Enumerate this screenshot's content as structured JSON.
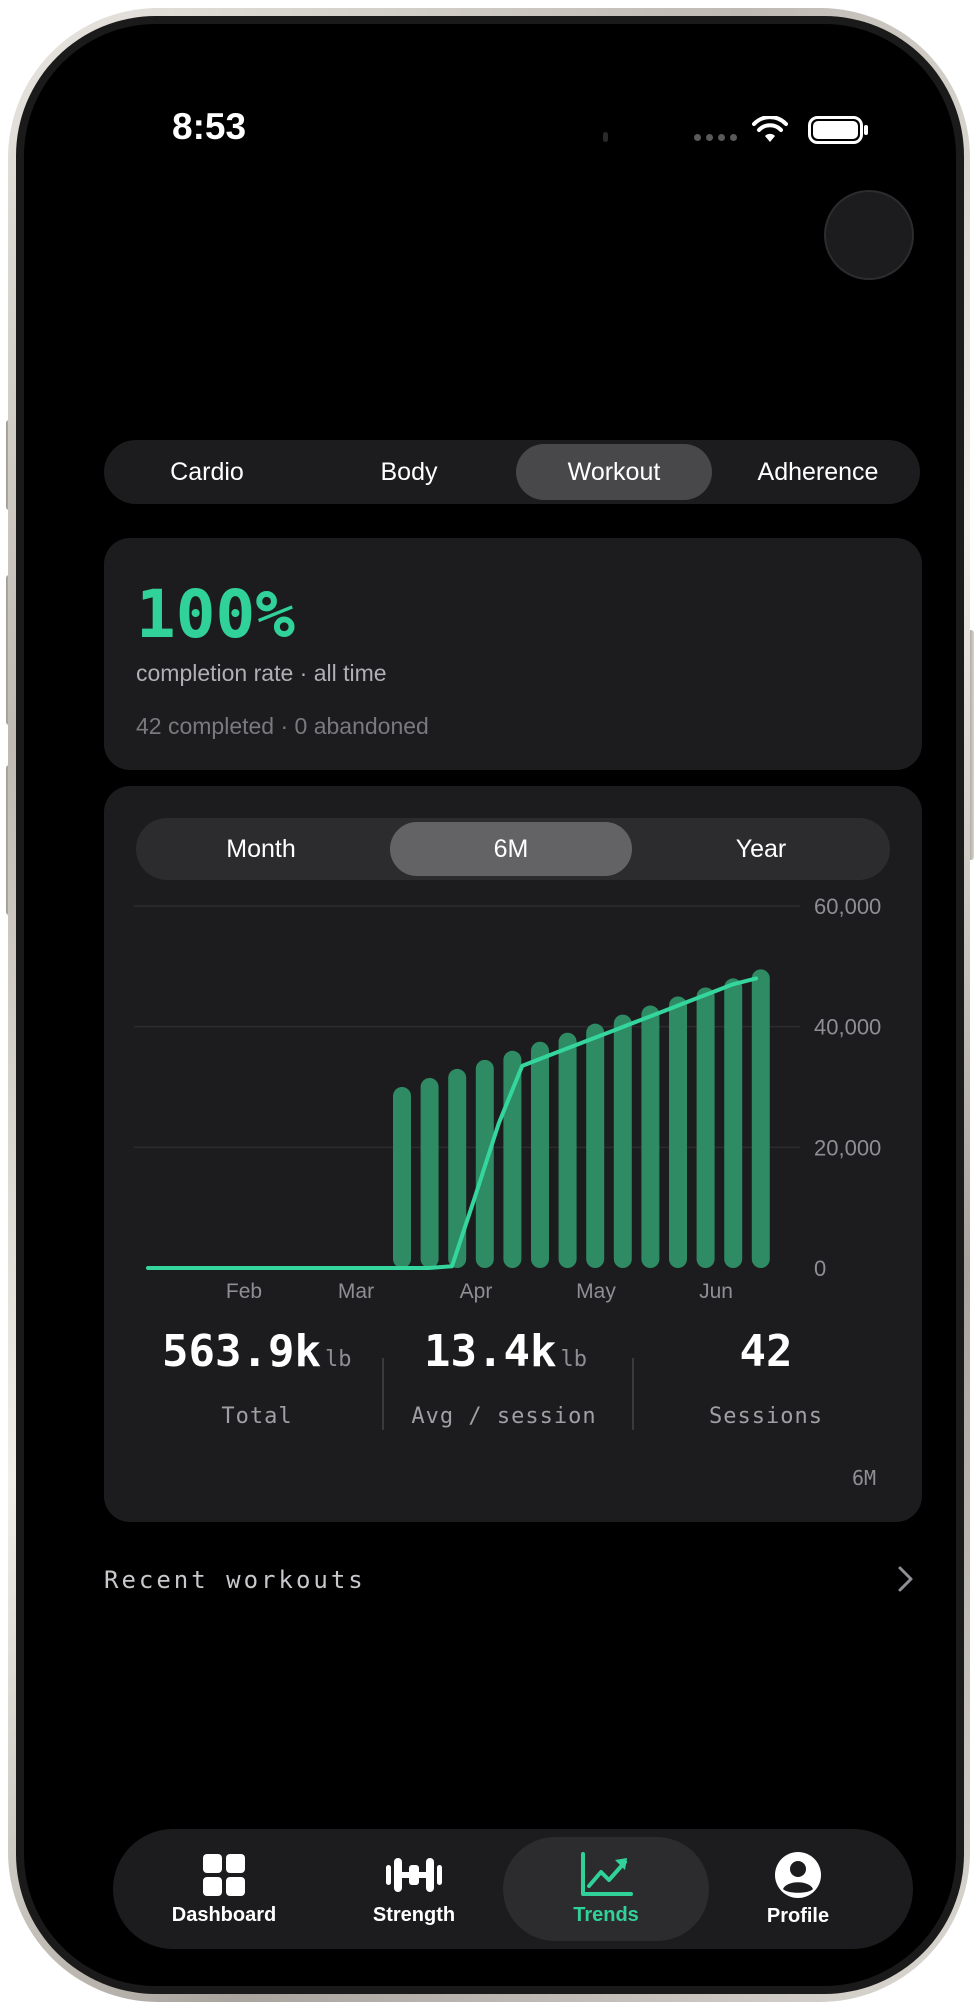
{
  "status": {
    "time": "8:53"
  },
  "segments": [
    {
      "label": "Cardio",
      "active": false
    },
    {
      "label": "Body",
      "active": false
    },
    {
      "label": "Workout",
      "active": true
    },
    {
      "label": "Adherence",
      "active": false
    }
  ],
  "completion": {
    "percent": "100%",
    "label": "completion rate · all time",
    "detail": "42 completed · 0 abandoned"
  },
  "periods": [
    {
      "label": "Month",
      "active": false
    },
    {
      "label": "6M",
      "active": true
    },
    {
      "label": "Year",
      "active": false
    }
  ],
  "chart_data": {
    "type": "bar",
    "title": "",
    "xlabel": "",
    "ylabel": "",
    "x_tick_labels": [
      "Feb",
      "Mar",
      "Apr",
      "May",
      "Jun"
    ],
    "y_tick_labels": [
      "60,000",
      "40,000",
      "20,000",
      "0"
    ],
    "ylim": [
      0,
      60000
    ],
    "grid": true,
    "bar_color": "#2e8b64",
    "line_color": "#34d69e",
    "series": [
      {
        "type": "bar",
        "values": [
          30000,
          31500,
          33000,
          34500,
          36000,
          37500,
          39000,
          40500,
          42000,
          43500,
          45000,
          46500,
          48000,
          49500
        ]
      },
      {
        "type": "line",
        "x_start": "Jan",
        "values": [
          0,
          0,
          0,
          0,
          0,
          0,
          0,
          0,
          0,
          0,
          0,
          0,
          0,
          300,
          12000,
          24000,
          33500,
          35000,
          36500,
          38000,
          39500,
          41000,
          42500,
          44000,
          45500,
          47000,
          48000
        ]
      }
    ]
  },
  "stats": [
    {
      "value": "563.9k",
      "unit": "lb",
      "label": "Total"
    },
    {
      "value": "13.4k",
      "unit": "lb",
      "label": "Avg / session"
    },
    {
      "value": "42",
      "unit": "",
      "label": "Sessions"
    }
  ],
  "stats_period": "6M",
  "recent": {
    "label": "Recent workouts"
  },
  "tabbar": [
    {
      "label": "Dashboard",
      "icon": "grid-icon",
      "active": false
    },
    {
      "label": "Strength",
      "icon": "dumbbell-icon",
      "active": false
    },
    {
      "label": "Trends",
      "icon": "trend-chart-icon",
      "active": true
    },
    {
      "label": "Profile",
      "icon": "person-circle-icon",
      "active": false
    }
  ],
  "colors": {
    "accent": "#30d29a",
    "background": "#000000",
    "card": "#1c1c1e"
  }
}
